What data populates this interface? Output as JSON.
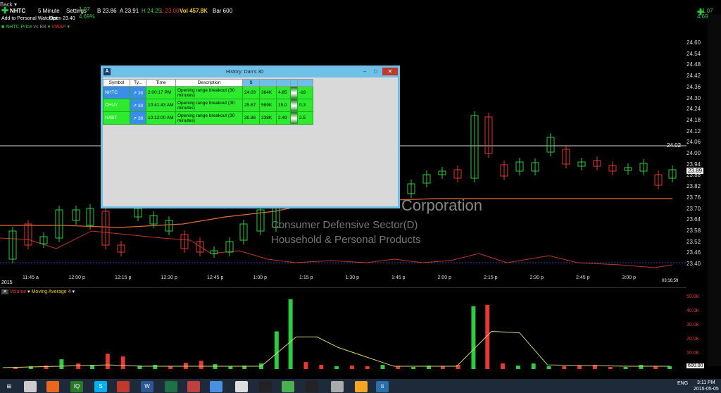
{
  "menu": {
    "label": "Back"
  },
  "toolbar": {
    "symbol": "NHTC",
    "interval": "5 Minute",
    "settings": "Settings",
    "change": "1.07",
    "change_pct": "4.69%",
    "bid": "B 23.86",
    "ask": "A 23.91",
    "high": "H 24.25",
    "low": "L 23.00",
    "vol": "Vol 457.8K",
    "bar": "Bar 600",
    "open": "Open 23.40",
    "add_watchlist": "Add to Personal Watchlist",
    "indicator1": "NHTC Price",
    "indicator2": "VWAP",
    "indicator_vs": "vs BB"
  },
  "right_summary": {
    "change": "1.07",
    "change_pct": "4.69%"
  },
  "price_axis": [
    "24.60",
    "24.54",
    "24.48",
    "24.42",
    "24.36",
    "24.30",
    "24.24",
    "24.18",
    "24.12",
    "24.06",
    "24.00",
    "23.94",
    "23.88",
    "23.82",
    "23.76",
    "23.70",
    "23.64",
    "23.58",
    "23.52",
    "23.46",
    "23.40"
  ],
  "price_markers": {
    "line_level": "24.02",
    "current": "23.89",
    "time": "03:16:59"
  },
  "time_axis": [
    "11:45 a",
    "12:00 p",
    "12:15 p",
    "12:30 p",
    "12:45 p",
    "1:00 p",
    "1:15 p",
    "1:30 p",
    "1:45 p",
    "2:00 p",
    "2:15 p",
    "2:30 p",
    "2:45 p",
    "3:00 p"
  ],
  "year_label": "2015",
  "watermark": {
    "company": "Corporation",
    "sector": "Consumer Defensive Sector(D)",
    "industry": "Household & Personal Products"
  },
  "volume_panel": {
    "title": "Volume",
    "ma": "Moving Average 4",
    "axis": [
      "50.0K",
      "40.0K",
      "30.0K",
      "20.0K",
      "10.0K"
    ],
    "current": "600.00"
  },
  "history": {
    "title": "History:  Dan's 30",
    "columns": [
      "Symbol",
      "Ty...",
      "Time",
      "Description",
      "$",
      "",
      "",
      "",
      "",
      ""
    ],
    "rows": [
      {
        "symbol": "NHTC",
        "type": "30",
        "time": "2:00:17 PM",
        "desc": "Opening range breakout (30 minutes)",
        "price": "24.03",
        "vol": "364K",
        "c3": "4.85",
        "c5": "-16"
      },
      {
        "symbol": "CHUY",
        "type": "30",
        "time": "10:41:43 AM",
        "desc": "Opening range breakout (30 minutes)",
        "price": "25.67",
        "vol": "569K",
        "c3": "15.0",
        "c5": "0.3"
      },
      {
        "symbol": "HABT",
        "type": "30",
        "time": "10:12:00 AM",
        "desc": "Opening range breakout (30 minutes)",
        "price": "30.86",
        "vol": "238K",
        "c3": "2.49",
        "c5": "2.5"
      }
    ]
  },
  "taskbar": {
    "lang": "ENG",
    "time": "3:11 PM",
    "date": "2015-05-05"
  },
  "colors": {
    "up": "#2ecc40",
    "down": "#e53935",
    "vwap": "#c0392b",
    "window": "#6ec0e8"
  }
}
